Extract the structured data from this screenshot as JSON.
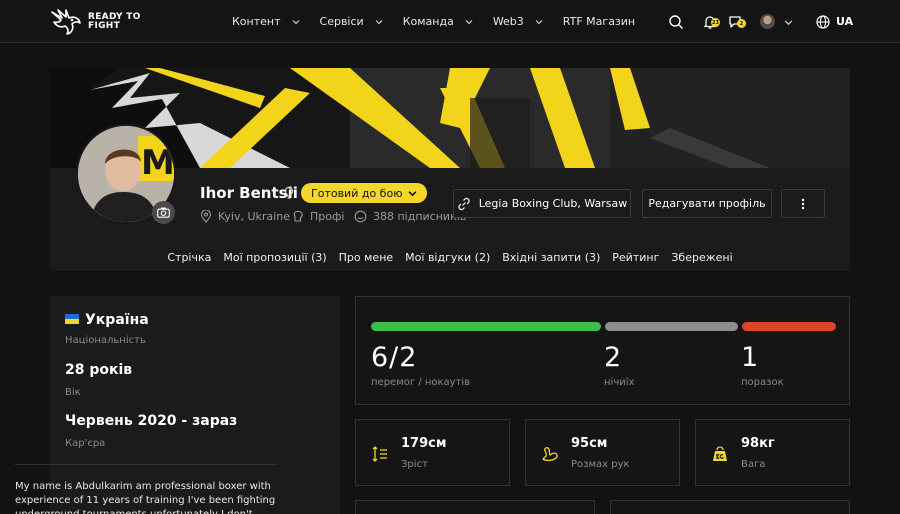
{
  "header": {
    "logo_line1": "READY TO",
    "logo_line2": "FIGHT",
    "nav": [
      {
        "label": "Контент",
        "dropdown": true
      },
      {
        "label": "Сервіси",
        "dropdown": true
      },
      {
        "label": "Команда",
        "dropdown": true
      },
      {
        "label": "Web3",
        "dropdown": true
      },
      {
        "label": "RTF Магазин",
        "dropdown": false
      }
    ],
    "notifications_count": "23",
    "messages_count": "2",
    "language": "UA"
  },
  "profile": {
    "name": "Ihor Bentsii",
    "status": "Готовий до бою",
    "location": "Kyiv, Ukraine",
    "level": "Профі",
    "followers": "388 підписників",
    "club_button": "Legia Boxing Club, Warsaw",
    "edit_button": "Редагувати профіль"
  },
  "tabs": [
    "Стрічка",
    "Мої пропозиції (3)",
    "Про мене",
    "Мої відгуки (2)",
    "Вхідні запити (3)",
    "Рейтинг",
    "Збережені"
  ],
  "info": {
    "country": "Україна",
    "country_label": "Національність",
    "age": "28 років",
    "age_label": "Вік",
    "career": "Червень 2020 - зараз",
    "career_label": "Кар'єра",
    "bio": "My name is Abdulkarim am professional boxer with experience of 11 years of training I've been fighting underground tournaments unfortunately I don't have"
  },
  "record": {
    "wins": "6/2",
    "wins_label": "перемог / нокаутів",
    "draws": "2",
    "draws_label": "нічиїх",
    "losses": "1",
    "losses_label": "поразок",
    "colors": {
      "wins": "#3cbd4e",
      "draws": "#8e8e8e",
      "losses": "#e0452c"
    }
  },
  "measurements": {
    "height": "179см",
    "height_label": "Зріст",
    "reach": "95см",
    "reach_label": "Розмах рук",
    "weight": "98кг",
    "weight_label": "Вага"
  },
  "colors": {
    "accent": "#f4d72b",
    "background": "#121212",
    "panel": "#1b1b1b"
  }
}
